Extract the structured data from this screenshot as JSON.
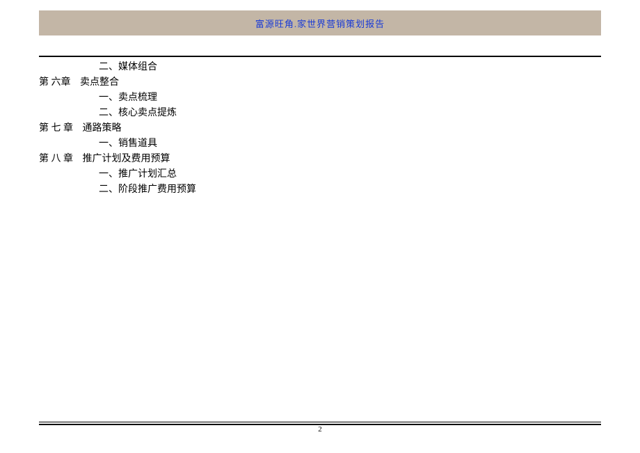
{
  "header": {
    "title": "富源旺角.家世界营销策划报告"
  },
  "toc": {
    "pre_subs": [
      "二、媒体组合"
    ],
    "chapters": [
      {
        "label": "第 六章",
        "title": "卖点整合",
        "subs": [
          "一、卖点梳理",
          "二、核心卖点提炼"
        ]
      },
      {
        "label": "第 七 章",
        "title": "通路策略",
        "subs": [
          "一、销售道具"
        ]
      },
      {
        "label": "第 八 章",
        "title": "推广计划及费用预算",
        "subs": [
          "一、推广计划汇总",
          "二、阶段推广费用预算"
        ]
      }
    ]
  },
  "footer": {
    "page_number": "2"
  }
}
